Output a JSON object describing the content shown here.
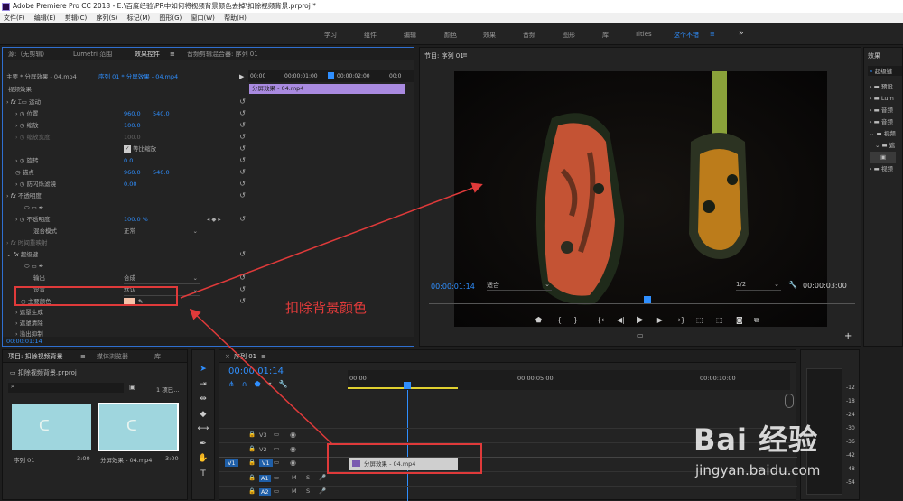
{
  "titlebar": {
    "text": "Adobe Premiere Pro CC 2018 - E:\\百度经验\\PR中如何将视频背景颜色去掉\\扣除视频背景.prproj *"
  },
  "menu": [
    "文件(F)",
    "编辑(E)",
    "剪辑(C)",
    "序列(S)",
    "标记(M)",
    "图形(G)",
    "窗口(W)",
    "帮助(H)"
  ],
  "workspaces": [
    "学习",
    "组件",
    "编辑",
    "颜色",
    "效果",
    "音频",
    "图形",
    "库",
    "Titles",
    "这个不错"
  ],
  "effect_panel": {
    "tabs": [
      "源:（无剪辑）",
      "Lumetri 范围",
      "效果控件",
      "音频剪辑混合器: 序列 01"
    ],
    "clip_path": "主要 * 分屏效果 - 04.mp4",
    "seq_path": "序列 01 * 分屏效果 - 04.mp4",
    "ruler": [
      "00:00",
      "00:00:01:00",
      "00:00:02:00",
      "00:0"
    ],
    "clip_bar": "分屏效果 - 04.mp4",
    "section": "视频效果",
    "motion": "运动",
    "position_label": "位置",
    "position_x": "960.0",
    "position_y": "540.0",
    "scale_label": "缩放",
    "scale_val": "100.0",
    "scalew_label": "缩放宽度",
    "scalew_val": "100.0",
    "uniform_label": "等比缩放",
    "rotation_label": "旋转",
    "rotation_val": "0.0",
    "anchor_label": "锚点",
    "anchor_x": "960.0",
    "anchor_y": "540.0",
    "flicker_label": "防闪烁滤镜",
    "flicker_val": "0.00",
    "opacity": "不透明度",
    "opacity_label": "不透明度",
    "opacity_val": "100.0 %",
    "blend_label": "混合模式",
    "blend_val": "正常",
    "timeremap": "时间重映射",
    "ultra": "超级键",
    "output_label": "输出",
    "output_val": "合成",
    "setting_label": "设置",
    "setting_val": "默认",
    "keycolor_label": "主要颜色",
    "matte_gen": "遮罩生成",
    "matte_clean": "遮罩清除",
    "spill": "溢出抑制",
    "timecode": "00:00:01:14"
  },
  "program": {
    "title": "节目: 序列 01",
    "timecode": "00:00:01:14",
    "fit": "适合",
    "ratio": "1/2",
    "duration": "00:00:03:00"
  },
  "right_panel": {
    "title": "效果",
    "items": [
      "超级键",
      "预设",
      "Lum",
      "音频",
      "音频",
      "视频",
      "遮",
      "",
      "视频"
    ]
  },
  "project": {
    "tabs": [
      "项目: 扣除视频背景",
      "媒体浏览器",
      "库"
    ],
    "file": "扣除视频背景.prproj",
    "count": "1 项已...",
    "items": [
      {
        "name": "序列 01",
        "dur": "3:00"
      },
      {
        "name": "分屏效果 - 04.mp4",
        "dur": "3:00"
      }
    ]
  },
  "timeline": {
    "tab": "序列 01",
    "timecode": "00:00:01:14",
    "ruler": [
      "00:00",
      "00:00:05:00",
      "00:00:10:00"
    ],
    "tracks": [
      "V3",
      "V2",
      "V1",
      "A1",
      "A2"
    ],
    "clip": "分屏效果 - 04.mp4",
    "meter_labels": [
      "-12",
      "-18",
      "-24",
      "-30",
      "-36",
      "-42",
      "-48",
      "-54"
    ]
  },
  "annotation": {
    "text": "扣除背景颜色",
    "color": "#e03a3a"
  },
  "watermark": {
    "brand": "Bai 经验",
    "url": "jingyan.baidu.com"
  }
}
